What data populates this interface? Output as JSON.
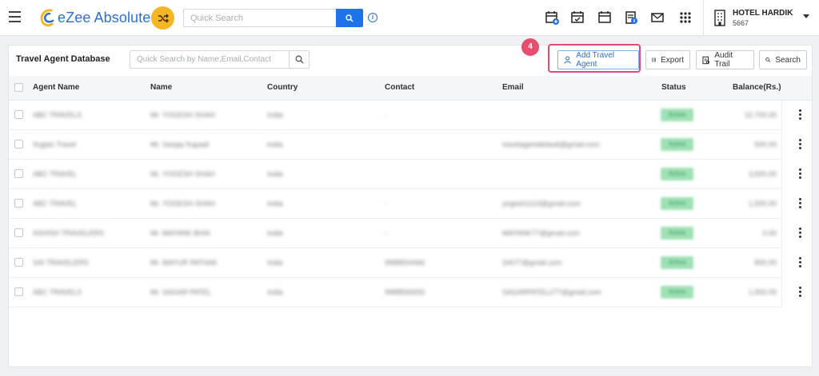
{
  "app": {
    "name": "eZee Absolute"
  },
  "topbar": {
    "search_placeholder": "Quick Search",
    "hotel_name": "HOTEL HARDIK",
    "hotel_code": "5667",
    "icons": [
      "calendar-plus-icon",
      "calendar-check-icon",
      "calendar-icon",
      "invoice-icon",
      "mail-icon",
      "apps-grid-icon"
    ]
  },
  "panel": {
    "title": "Travel Agent Database",
    "search_placeholder": "Quick Search by Name,Email,Contact",
    "step_number": "4",
    "buttons": {
      "add": "Add Travel Agent",
      "export": "Export",
      "audit": "Audit Trail",
      "search": "Search"
    }
  },
  "table": {
    "columns": [
      "Agent Name",
      "Name",
      "Country",
      "Contact",
      "Email",
      "Status",
      "Balance(Rs.)"
    ],
    "rows": [
      {
        "agent": "ABC TRAVELS",
        "name": "Mr. YOGESH SHAH",
        "country": "India",
        "contact": "-",
        "email": "",
        "status": "Active",
        "balance": "12,700.00"
      },
      {
        "agent": "Sujjain Travel",
        "name": "Mr. Sanjay Kapadi",
        "country": "India",
        "contact": "",
        "email": "travelagentdefault@gmail.com",
        "status": "Active",
        "balance": "500.00"
      },
      {
        "agent": "ABC TRAVEL",
        "name": "Mr. YOGESH SHAH",
        "country": "India",
        "contact": "",
        "email": "",
        "status": "Active",
        "balance": "3,500.00"
      },
      {
        "agent": "ABC TRAVEL",
        "name": "Mr. YOGESH SHAH",
        "country": "India",
        "contact": "-",
        "email": "yogesh1113@gmail.com",
        "status": "Active",
        "balance": "1,500.00"
      },
      {
        "agent": "ASHISH TRAVELERS",
        "name": "Mr. MAYANK BHAI",
        "country": "India",
        "contact": "-",
        "email": "MAYANK77@gmail.com",
        "status": "Active",
        "balance": "0.00"
      },
      {
        "agent": "SAI TRAVELERS",
        "name": "Mr. MAYUR PATHAK",
        "country": "India",
        "contact": "9988554466",
        "email": "SAI77@gmail.com",
        "status": "Active",
        "balance": "800.00"
      },
      {
        "agent": "ABC TRAVELS",
        "name": "Mr. SAGAR PATEL",
        "country": "India",
        "contact": "9988556655",
        "email": "SAGARPATEL277@gmail.com",
        "status": "Active",
        "balance": "1,500.00"
      }
    ]
  }
}
